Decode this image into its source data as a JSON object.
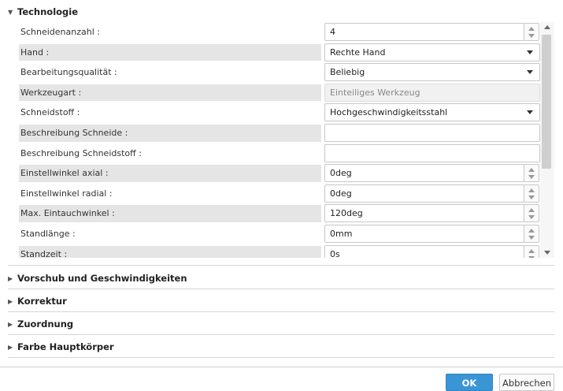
{
  "sections": {
    "technologie": "Technologie",
    "vorschub": "Vorschub und Geschwindigkeiten",
    "korrektur": "Korrektur",
    "zuordnung": "Zuordnung",
    "farbe": "Farbe Hauptkörper"
  },
  "rows": [
    {
      "label": "Schneidenanzahl :",
      "value": "4",
      "type": "spin"
    },
    {
      "label": "Hand :",
      "value": "Rechte Hand",
      "type": "select"
    },
    {
      "label": "Bearbeitungsqualität :",
      "value": "Beliebig",
      "type": "select"
    },
    {
      "label": "Werkzeugart :",
      "value": "Einteiliges Werkzeug",
      "type": "disabled"
    },
    {
      "label": "Schneidstoff :",
      "value": "Hochgeschwindigkeitsstahl",
      "type": "select"
    },
    {
      "label": "Beschreibung Schneide :",
      "value": "",
      "type": "text"
    },
    {
      "label": "Beschreibung Schneidstoff :",
      "value": "",
      "type": "text"
    },
    {
      "label": "Einstellwinkel axial :",
      "value": "0deg",
      "type": "spin"
    },
    {
      "label": "Einstellwinkel radial :",
      "value": "0deg",
      "type": "spin"
    },
    {
      "label": "Max. Eintauchwinkel :",
      "value": "120deg",
      "type": "spin"
    },
    {
      "label": "Standlänge :",
      "value": "0mm",
      "type": "spin"
    },
    {
      "label": "Standzeit :",
      "value": "0s",
      "type": "spin"
    }
  ],
  "buttons": {
    "ok": "OK",
    "cancel": "Abbrechen"
  },
  "colors": {
    "accent": "#3a95d5",
    "row_alt": "#e5e5e5"
  },
  "icons": {
    "expanded": "triangle-down-icon",
    "collapsed": "triangle-right-icon"
  }
}
